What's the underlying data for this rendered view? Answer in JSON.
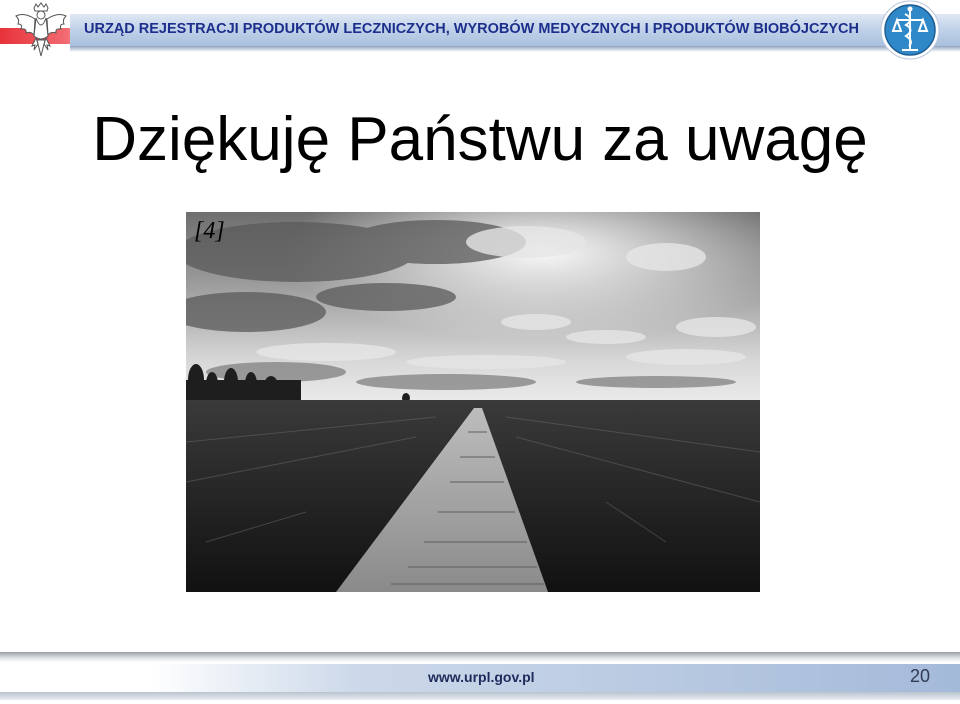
{
  "header": {
    "title": "URZĄD REJESTRACJI PRODUKTÓW LECZNICZYCH, WYROBÓW MEDYCZNYCH I PRODUKTÓW BIOBÓJCZYCH",
    "left_logo_icon": "polish-eagle-emblem",
    "right_logo_icon": "urpl-caduceus-scales-logo"
  },
  "main": {
    "title": "Dziękuję Państwu za uwagę",
    "photo": {
      "label": "[4]",
      "icon": "boardwalk-landscape-photo"
    }
  },
  "footer": {
    "url": "www.urpl.gov.pl",
    "page_number": "20"
  },
  "colors": {
    "header_text": "#1d2f8c",
    "header_band": "#c2d3e9",
    "accent_red": "#e8323a",
    "footer_band": "#a4bad9"
  }
}
